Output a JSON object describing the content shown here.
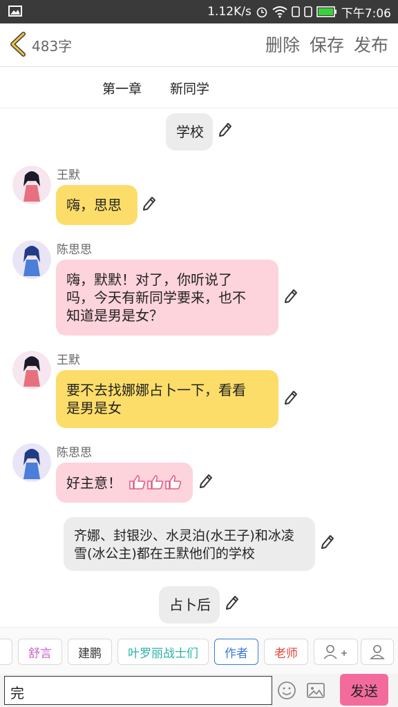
{
  "status_bar": {
    "speed": "1.12K/s",
    "time": "下午7:06"
  },
  "header": {
    "word_count": "483字",
    "delete": "删除",
    "save": "保存",
    "publish": "发布"
  },
  "chapter": {
    "number": "第一章",
    "title": "新同学"
  },
  "messages": [
    {
      "type": "narration",
      "text": "学校"
    },
    {
      "type": "speech",
      "speaker": "王默",
      "text": "嗨，思思",
      "color": "#fddd69"
    },
    {
      "type": "speech",
      "speaker": "陈思思",
      "lines": [
        "嗨，默默！对了，你听说了",
        "吗，今天有新同学要来，也不",
        "知道是男是女？"
      ],
      "color": "#fdd3dc"
    },
    {
      "type": "speech",
      "speaker": "王默",
      "lines": [
        "要不去找娜娜占卜一下，看看",
        "是男是女"
      ],
      "color": "#fddd69"
    },
    {
      "type": "speech",
      "speaker": "陈思思",
      "text": "好主意！",
      "emoji": "thumbs-up x3",
      "color": "#fdd3dc"
    },
    {
      "type": "narration",
      "lines": [
        "齐娜、封银沙、水灵泊(水王子)和冰凌",
        "雪(冰公主)都在王默他们的学校"
      ]
    },
    {
      "type": "narration",
      "text": "占卜后"
    }
  ],
  "characters": [
    {
      "label": "舒言",
      "color": "#c863c8"
    },
    {
      "label": "建鹏",
      "color": "#333333"
    },
    {
      "label": "叶罗丽战士们",
      "color": "#2ab0a8"
    },
    {
      "label": "作者",
      "color": "#3a7bd5"
    },
    {
      "label": "老师",
      "color": "#e0463a"
    }
  ],
  "input": {
    "value": "完",
    "send": "发送"
  }
}
